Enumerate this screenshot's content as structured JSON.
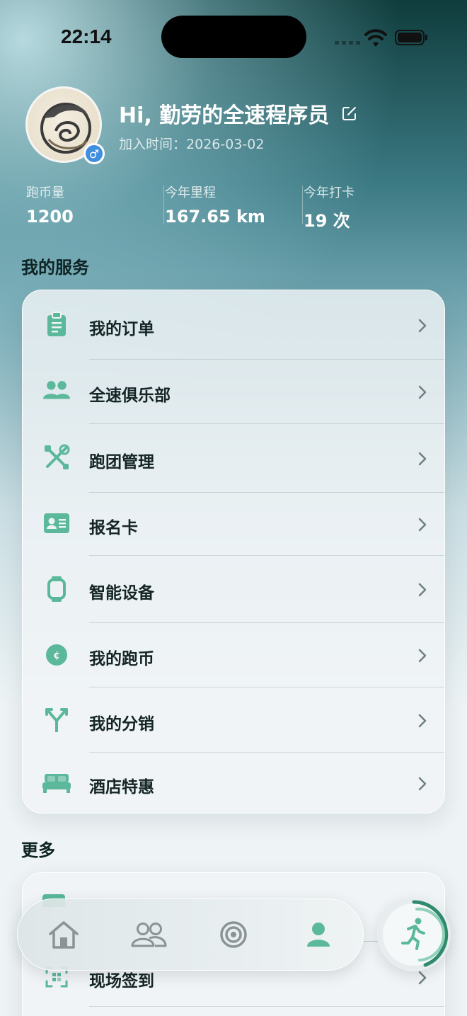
{
  "status_bar": {
    "time": "22:14"
  },
  "profile": {
    "greeting": "Hi, 勤劳的全速程序员",
    "join_label": "加入时间：",
    "join_date": "2026-03-02",
    "gender_symbol": "♂"
  },
  "stats": [
    {
      "label": "跑币量",
      "value": "1200"
    },
    {
      "label": "今年里程",
      "value": "167.65 km"
    },
    {
      "label": "今年打卡",
      "value": "19 次"
    }
  ],
  "services": {
    "title": "我的服务",
    "items": [
      {
        "label": "我的订单",
        "icon": "clipboard-icon"
      },
      {
        "label": "全速俱乐部",
        "icon": "people-icon"
      },
      {
        "label": "跑团管理",
        "icon": "tools-icon"
      },
      {
        "label": "报名卡",
        "icon": "id-card-icon"
      },
      {
        "label": "智能设备",
        "icon": "smartwatch-icon"
      },
      {
        "label": "我的跑币",
        "icon": "coin-icon"
      },
      {
        "label": "我的分销",
        "icon": "split-arrow-icon"
      },
      {
        "label": "酒店特惠",
        "icon": "bed-icon"
      }
    ]
  },
  "more": {
    "title": "更多",
    "items": [
      {
        "label": "现场签到",
        "icon": "qr-scan-icon"
      }
    ]
  },
  "tabbar": {
    "tabs": [
      {
        "name": "home",
        "icon": "home-icon",
        "active": false
      },
      {
        "name": "community",
        "icon": "people-outline-icon",
        "active": false
      },
      {
        "name": "target",
        "icon": "target-icon",
        "active": false
      },
      {
        "name": "me",
        "icon": "person-icon",
        "active": true
      }
    ],
    "run_button_icon": "runner-icon"
  },
  "colors": {
    "accent": "#5bb89a",
    "accent_dark": "#2f8a6c",
    "gender_badge": "#3f8ee0"
  }
}
